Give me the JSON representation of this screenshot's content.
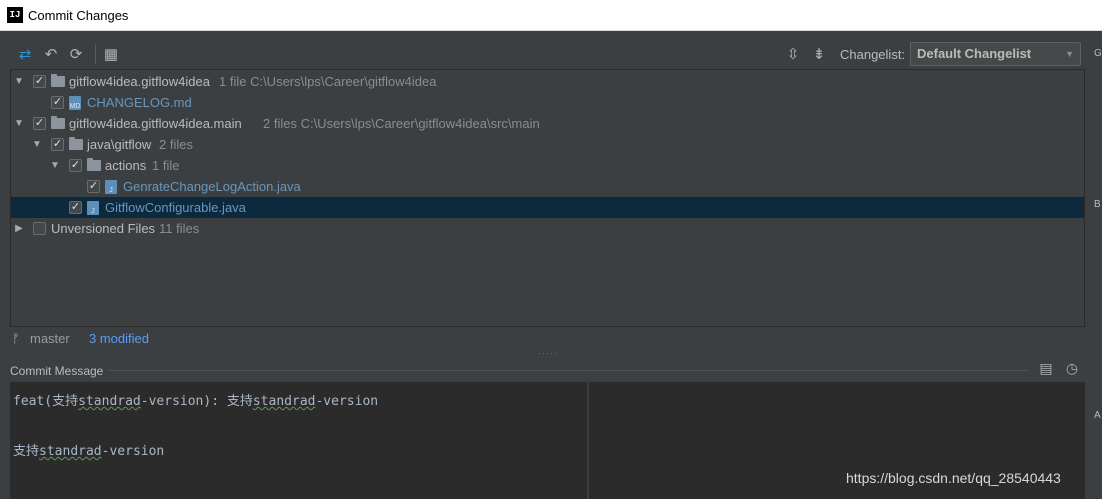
{
  "window": {
    "title": "Commit Changes",
    "logo_text": "IJ"
  },
  "toolbar": {
    "icons": [
      "diff-arrows-icon",
      "undo-icon",
      "refresh-icon",
      "group-by-icon",
      "expand-all-icon",
      "collapse-all-icon"
    ],
    "changelist_label": "Changelist:",
    "changelist_value": "Default Changelist"
  },
  "tree": {
    "rows": [
      {
        "name": "gitflow4idea.gitflow4idea",
        "meta": "1 file  C:\\Users\\lps\\Career\\gitflow4idea"
      },
      {
        "name": "CHANGELOG.md",
        "meta": ""
      },
      {
        "name": "gitflow4idea.gitflow4idea.main",
        "meta": "2 files  C:\\Users\\lps\\Career\\gitflow4idea\\src\\main"
      },
      {
        "name": "java\\gitflow",
        "meta": "2 files"
      },
      {
        "name": "actions",
        "meta": "1 file"
      },
      {
        "name": "GenrateChangeLogAction.java",
        "meta": ""
      },
      {
        "name": "GitflowConfigurable.java",
        "meta": ""
      },
      {
        "name": "Unversioned Files",
        "meta": "11 files"
      }
    ]
  },
  "status": {
    "branch": "master",
    "modified": "3 modified"
  },
  "commit": {
    "label": "Commit Message",
    "line1_prefix": "feat(支持",
    "line1_word1": "standrad",
    "line1_mid": "-version): 支持",
    "line1_word2": "standrad",
    "line1_suffix": "-version",
    "line3_prefix": "支持",
    "line3_word": "standrad",
    "line3_suffix": "-version"
  },
  "edge_letters": [
    "G",
    "B",
    "A"
  ],
  "watermark": "https://blog.csdn.net/qq_28540443"
}
